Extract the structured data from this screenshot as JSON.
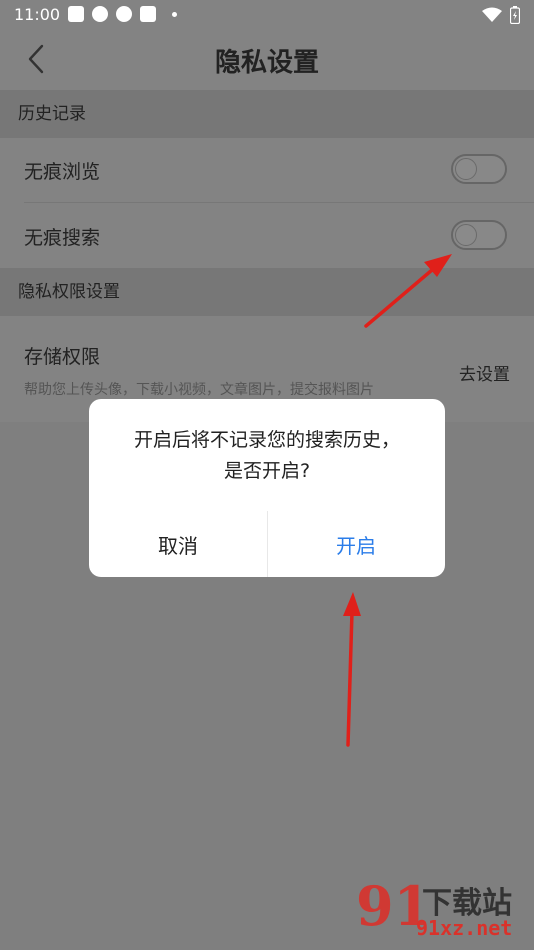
{
  "status_bar": {
    "time": "11:00"
  },
  "header": {
    "title": "隐私设置"
  },
  "sections": {
    "history": {
      "title": "历史记录"
    },
    "privacy": {
      "title": "隐私权限设置"
    }
  },
  "rows": {
    "incognito_browse": {
      "label": "无痕浏览",
      "enabled": false
    },
    "incognito_search": {
      "label": "无痕搜索",
      "enabled": false
    },
    "storage": {
      "label": "存储权限",
      "description": "帮助您上传头像，下载小视频，文章图片，提交报料图片",
      "action": "去设置"
    }
  },
  "dialog": {
    "message_line1": "开启后将不记录您的搜索历史，",
    "message_line2": "是否开启?",
    "cancel_label": "取消",
    "confirm_label": "开启"
  },
  "watermark": {
    "logo": "91",
    "title": "下载站",
    "url": "91xz.net"
  },
  "colors": {
    "accent": "#2b7de9",
    "overlay": "#7f7f7f",
    "arrow": "#e0201a"
  }
}
